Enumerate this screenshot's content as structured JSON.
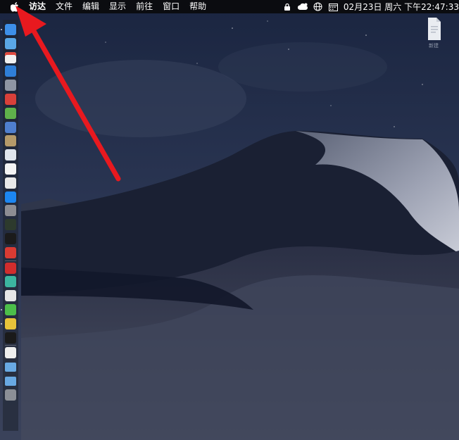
{
  "menubar": {
    "items": [
      "访达",
      "文件",
      "编辑",
      "显示",
      "前往",
      "窗口",
      "帮助"
    ],
    "clock": "02月23日 周六 下午22:47:33"
  },
  "dock": {
    "apps": [
      {
        "name": "finder",
        "color": "#3d8fe8"
      },
      {
        "name": "safari-globe",
        "color": "#5aa7e6"
      },
      {
        "name": "calendar",
        "color": "#f1f1f1"
      },
      {
        "name": "safari",
        "color": "#2f7fd8"
      },
      {
        "name": "launchpad",
        "color": "#8e95a3"
      },
      {
        "name": "app-red",
        "color": "#d8403a"
      },
      {
        "name": "android",
        "color": "#5fb14b"
      },
      {
        "name": "preview",
        "color": "#4f7fcf"
      },
      {
        "name": "archive",
        "color": "#b59a6a"
      },
      {
        "name": "photos",
        "color": "#e0e6ee"
      },
      {
        "name": "textedit",
        "color": "#f4f4f4"
      },
      {
        "name": "notes",
        "color": "#e8e8e8"
      },
      {
        "name": "app-store",
        "color": "#1c86f2"
      },
      {
        "name": "system-preferences",
        "color": "#8d8d93"
      },
      {
        "name": "activity-monitor",
        "color": "#2d3a2d"
      },
      {
        "name": "terminal",
        "color": "#1b1b1b"
      },
      {
        "name": "vivaldi",
        "color": "#d93b33"
      },
      {
        "name": "netease-music",
        "color": "#d12d2d"
      },
      {
        "name": "browser-green",
        "color": "#3cb6a0"
      },
      {
        "name": "yandex",
        "color": "#e6e6e6"
      },
      {
        "name": "wechat",
        "color": "#4cbf4a"
      },
      {
        "name": "money-app",
        "color": "#e6c33a"
      },
      {
        "name": "qq",
        "color": "#1a1a1a"
      },
      {
        "name": "document",
        "color": "#eeeeee"
      },
      {
        "name": "folder-1",
        "color": "#69a9e3"
      },
      {
        "name": "folder-2",
        "color": "#69a9e3"
      },
      {
        "name": "trash",
        "color": "#8b8f96"
      }
    ]
  },
  "desktop": {
    "file_label": "新建"
  },
  "colors": {
    "menubar_bg": "#0b0c10",
    "arrow": "#e8191f",
    "sky_top": "#1f2a44",
    "dune_shadow": "#121726"
  }
}
